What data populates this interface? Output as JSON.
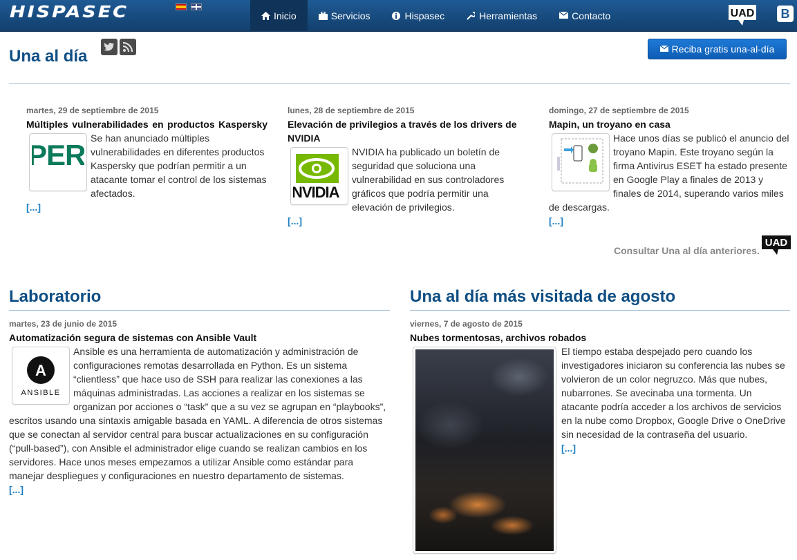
{
  "brand": {
    "logo_text": "HISPASEC"
  },
  "nav": {
    "items": [
      {
        "label": "Inicio",
        "icon": "home-icon",
        "active": true
      },
      {
        "label": "Servicios",
        "icon": "briefcase-icon"
      },
      {
        "label": "Hispasec",
        "icon": "info-icon"
      },
      {
        "label": "Herramientas",
        "icon": "wrench-icon"
      },
      {
        "label": "Contacto",
        "icon": "envelope-icon"
      }
    ],
    "uad_logo": "UAD",
    "blogger_letter": "B"
  },
  "una_al_dia": {
    "heading": "Una al día",
    "subscribe_label": "Reciba gratis una-al-día",
    "articles": [
      {
        "date": "martes, 29 de septiembre de 2015",
        "title": "Múltiples vulnerabilidades en productos Kaspersky",
        "body": "Se han anunciado múltiples vulnerabilidades en diferentes productos Kaspersky que podrían permitir a un atacante tomar el control de los sistemas afectados.",
        "more": "[...]",
        "thumb_text": "PERS"
      },
      {
        "date": "lunes, 28 de septiembre de 2015",
        "title": "Elevación de privilegios a través de los drivers de NVIDIA",
        "body": "NVIDIA ha publicado un boletín de seguridad que soluciona una vulnerabilidad en sus controladores gráficos que podría permitir una elevación de privilegios.",
        "more": "[...]",
        "thumb_text": "NVIDIA"
      },
      {
        "date": "domingo, 27 de septiembre de 2015",
        "title": "Mapin, un troyano en casa",
        "body": "Hace unos días se publicó el anuncio del troyano Mapin. Este troyano según la firma Antivirus ESET ha estado presente en Google Play a finales de 2013 y finales de 2014, superando varios miles de descargas.",
        "more": "[...]"
      }
    ],
    "consult_label": "Consultar Una al día anteriores.",
    "uad_logo": "UAD"
  },
  "laboratorio": {
    "heading": "Laboratorio",
    "date": "martes, 23 de junio de 2015",
    "title": "Automatización segura de sistemas con Ansible Vault",
    "body": "Ansible es una herramienta de automatización y administración de configuraciones remotas desarrollada en Python. Es un sistema “clientless” que hace uso de SSH para realizar las conexiones a las máquinas administradas. Las acciones a realizar en los sistemas se organizan por acciones o “task” que a su vez se agrupan en “playbooks”, escritos usando una sintaxis amigable basada en YAML. A diferencia de otros sistemas que se conectan al servidor central para buscar actualizaciones en su configuración (“pull-based”), con Ansible el administrador elige cuando se realizan cambios en los servidores. Hace unos meses empezamos a utilizar Ansible como estándar para manejar despliegues y configuraciones en nuestro departamento de sistemas.",
    "more": "[...]",
    "thumb_text": "ANSIBLE",
    "thumb_letter": "A"
  },
  "mas_visitada": {
    "heading": "Una al día más visitada de agosto",
    "date": "viernes, 7 de agosto de 2015",
    "title": "Nubes tormentosas, archivos robados",
    "body": "El tiempo estaba despejado pero cuando los investigadores iniciaron su conferencia las nubes se volvieron de un color negruzco. Más que nubes, nubarrones. Se avecinaba una tormenta. Un atacante podría acceder a los archivos de servicios en la nube como Dropbox, Google Drive o OneDrive sin necesidad de la contraseña del usuario.",
    "more": "[...]"
  },
  "colors": {
    "brand_blue": "#0f4e83",
    "link": "#1a7ec4",
    "nav_top": "#1f5a94",
    "button": "#1e7ad6"
  }
}
